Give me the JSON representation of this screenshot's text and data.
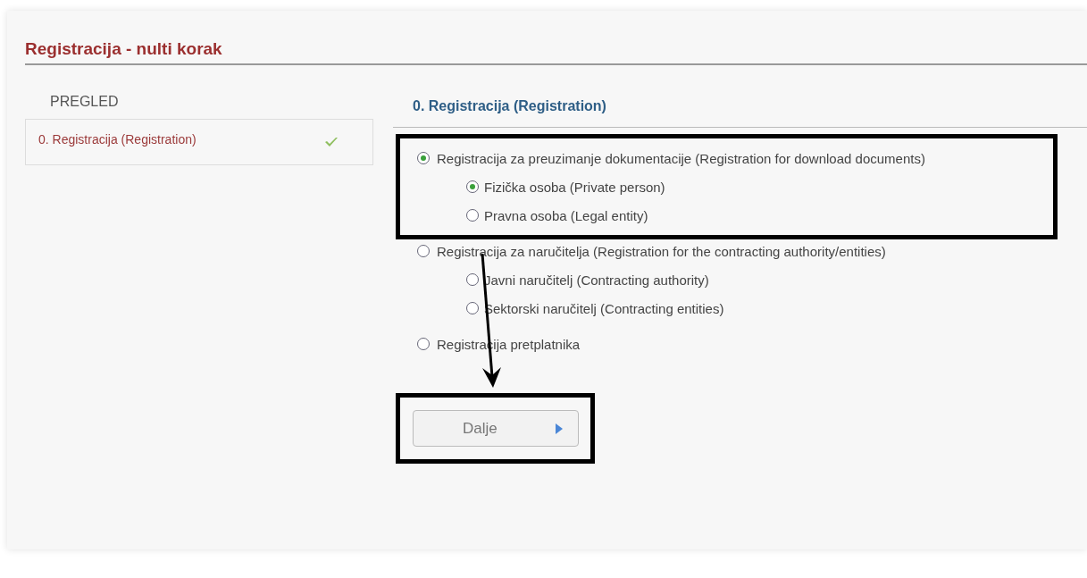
{
  "page_title": "Registracija - nulti korak",
  "sidebar": {
    "heading": "PREGLED",
    "items": [
      {
        "label": "0. Registracija (Registration)",
        "completed": true
      }
    ]
  },
  "section_title": "0. Registracija (Registration)",
  "options": [
    {
      "label": "Registracija za preuzimanje dokumentacije (Registration for download documents)",
      "selected": true,
      "children": [
        {
          "label": "Fizička osoba (Private person)",
          "selected": true
        },
        {
          "label": "Pravna osoba (Legal entity)",
          "selected": false
        }
      ]
    },
    {
      "label": "Registracija za naručitelja (Registration for the contracting authority/entities)",
      "selected": false,
      "children": [
        {
          "label": "Javni naručitelj (Contracting authority)",
          "selected": false
        },
        {
          "label": "Sektorski naručitelj (Contracting entities)",
          "selected": false
        }
      ]
    },
    {
      "label": "Registracija pretplatnika",
      "selected": false
    }
  ],
  "next_button": {
    "label": "Dalje",
    "disabled": true
  }
}
